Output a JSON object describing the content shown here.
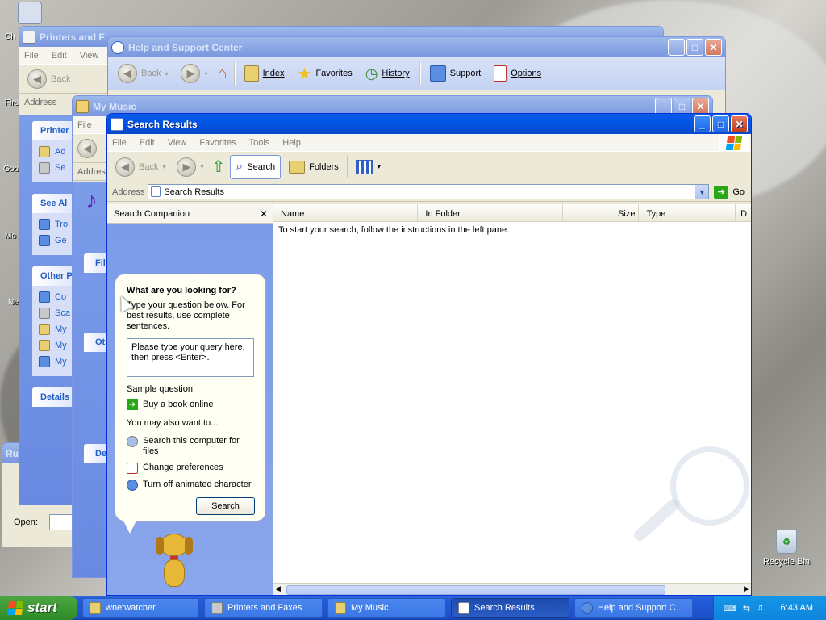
{
  "desktop": {
    "icons": [
      {
        "label": "Ch",
        "top": 0
      },
      {
        "label": "Fire",
        "top": 0
      },
      {
        "label": "Goo",
        "top": 0
      },
      {
        "label": "Mo",
        "top": 0
      },
      {
        "label": "Ne",
        "top": 0
      }
    ],
    "recycle_bin": "Recycle Bin"
  },
  "printers": {
    "title": "Printers and F",
    "menu": [
      "File",
      "Edit",
      "View"
    ],
    "back": "Back",
    "address": "Address",
    "tasks_title": "Printer",
    "tasks": [
      "Ad",
      "Se"
    ],
    "see_also_title": "See Al",
    "see_also": [
      "Tro",
      "Ge"
    ],
    "other_title": "Other P",
    "other": [
      "Co",
      "Sca",
      "My",
      "My",
      "My"
    ],
    "details_title": "Details"
  },
  "help": {
    "title": "Help and Support Center",
    "back": "Back",
    "index": "Index",
    "favorites": "Favorites",
    "history": "History",
    "support": "Support",
    "options": "Options"
  },
  "music": {
    "title": "My Music",
    "menu_file": "File",
    "address": "Addres",
    "file_title": "File",
    "other_title": "Oth",
    "details_title": "De"
  },
  "run": {
    "title": "Ru",
    "open_label": "Open:"
  },
  "search": {
    "title": "Search Results",
    "menu": [
      "File",
      "Edit",
      "View",
      "Favorites",
      "Tools",
      "Help"
    ],
    "toolbar": {
      "back": "Back",
      "search": "Search",
      "folders": "Folders"
    },
    "address_label": "Address",
    "address_value": "Search Results",
    "go": "Go",
    "companion_title": "Search Companion",
    "columns": [
      "Name",
      "In Folder",
      "Size",
      "Type",
      "D"
    ],
    "instructions": "To start your search, follow the instructions in the left pane.",
    "bubble": {
      "question": "What are you looking for?",
      "help": "Type your question below. For best results, use complete sentences.",
      "query_placeholder": "Please type your query here, then press <Enter>.",
      "sample_label": "Sample question:",
      "sample": "Buy a book online",
      "also_label": "You may also want to...",
      "options": [
        "Search this computer for files",
        "Change preferences",
        "Turn off animated character"
      ],
      "button": "Search"
    }
  },
  "taskbar": {
    "start": "start",
    "tasks": [
      "wnetwatcher",
      "Printers and Faxes",
      "My Music",
      "Search Results",
      "Help and Support C..."
    ],
    "clock": "6:43 AM"
  },
  "colors": {
    "xp_blue": "#0054e3",
    "taskbar": "#245edc",
    "start_green": "#3c9a34",
    "pane_blue": "#6a8ae2"
  }
}
